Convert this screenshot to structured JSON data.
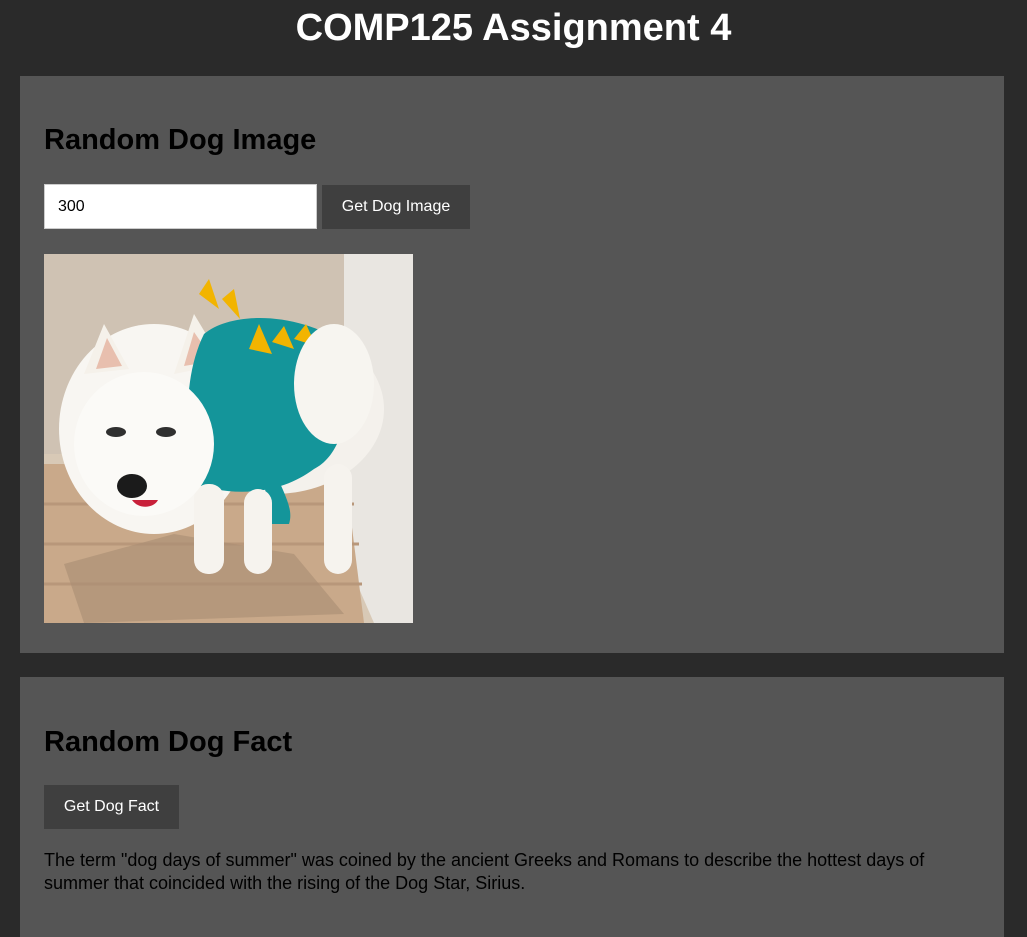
{
  "page": {
    "title": "COMP125 Assignment 4"
  },
  "dog_image_section": {
    "heading": "Random Dog Image",
    "size_input_value": "300",
    "button_label": "Get Dog Image",
    "image_alt": "Random dog photo"
  },
  "dog_fact_section": {
    "heading": "Random Dog Fact",
    "button_label": "Get Dog Fact",
    "fact_text": "The term \"dog days of summer\" was coined by the ancient Greeks and Romans to describe the hottest days of summer that coincided with the rising of the Dog Star, Sirius."
  },
  "colors": {
    "page_background": "#2a2a2a",
    "panel_background": "#555555",
    "button_background": "#3f3f3f",
    "title_text": "#ffffff"
  }
}
